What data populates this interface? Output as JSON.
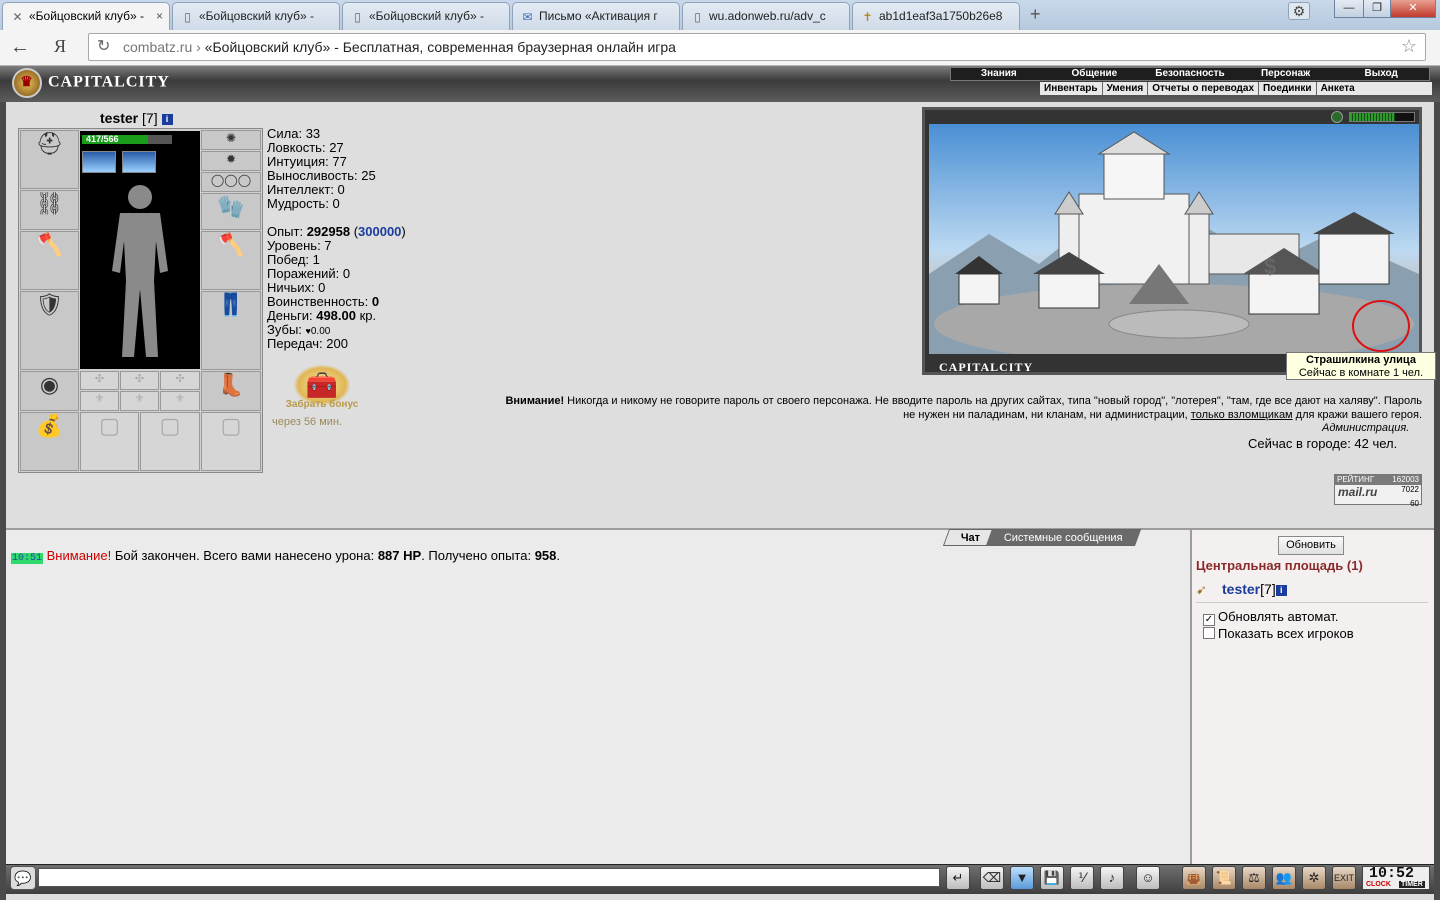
{
  "browser": {
    "tabs": [
      {
        "label": "«Бойцовский клуб» -",
        "icon": "swords-favicon",
        "active": true
      },
      {
        "label": "«Бойцовский клуб» -",
        "icon": "page-favicon"
      },
      {
        "label": "«Бойцовский клуб» -",
        "icon": "page-favicon"
      },
      {
        "label": "Письмо «Активация г",
        "icon": "mail-favicon"
      },
      {
        "label": "wu.adonweb.ru/adv_c",
        "icon": "page-favicon"
      },
      {
        "label": "ab1d1eaf3a1750b26e8",
        "icon": "cross-favicon"
      }
    ],
    "tab_close": "×",
    "new_tab": "+",
    "window_buttons": [
      "—",
      "❐",
      "✕"
    ],
    "back": "←",
    "yandex": "Я",
    "url_domain": "combatz.ru",
    "url_sep": " › ",
    "url_title": "«Бойцовский клуб» - Бесплатная, современная браузерная онлайн игра"
  },
  "game": {
    "logo": "CAPITALCITY",
    "nav_top": [
      "Знания",
      "Общение",
      "Безопасность",
      "Персонаж",
      "Выход"
    ],
    "nav_sub": [
      "Инвентарь",
      "Умения",
      "Отчеты о переводах",
      "Поединки",
      "Анкета"
    ],
    "character": {
      "name": "tester",
      "level": "[7]",
      "info": "i",
      "hp_text": "417/566",
      "hp_fraction": 0.737
    },
    "stats": [
      {
        "label": "Сила: ",
        "value": "33"
      },
      {
        "label": "Ловкость: ",
        "value": "27"
      },
      {
        "label": "Интуиция: ",
        "value": "77"
      },
      {
        "label": "Выносливость: ",
        "value": "25"
      },
      {
        "label": "Интеллект: ",
        "value": "0"
      },
      {
        "label": "Мудрость: ",
        "value": "0"
      }
    ],
    "stats2": {
      "exp_label": "Опыт: ",
      "exp_value": "292958",
      "exp_next": "300000",
      "level": "Уровень: 7",
      "wins": "Побед: 1",
      "losses": "Поражений: 0",
      "draws": "Ничьих: 0",
      "belligerence_label": "Воинственность: ",
      "belligerence_value": "0",
      "money_label": "Деньги: ",
      "money_value": "498.00",
      "money_unit": " кр.",
      "teeth_label": "Зубы: ",
      "teeth_value": "0.00",
      "transfers": "Передач: 200"
    },
    "bonus": {
      "label": "Забрать бонус",
      "time": "через 56 мин."
    },
    "map": {
      "caption": "CAPITALCITY",
      "tooltip_title": "Страшилкина улица",
      "tooltip_sub": "Сейчас в комнате 1 чел."
    },
    "warning": {
      "bold": "Внимание!",
      "text1": " Никогда и никому не говорите пароль от своего персонажа. Не вводите пароль на других сайтах, типа \"новый город\", \"лотерея\", \"там, где все дают на халяву\". Пароль не нужен ни паладинам, ни кланам, ни администрации, ",
      "link": "только взломщикам",
      "text2": " для кражи вашего героя.",
      "sign": "Администрация."
    },
    "online": "Сейчас в городе: 42 чел.",
    "rating": {
      "label": "РЕЙТИНГ",
      "v1": "162003",
      "v2": "7022",
      "v3": "60",
      "brand": "mail.ru"
    },
    "chat": {
      "tabs": [
        "Чат",
        "Системные сообщения"
      ],
      "message": {
        "time": "10:51",
        "warn": "Внимание!",
        "t1": " Бой закончен. Всего вами нанесено урона: ",
        "damage": "887 HP",
        "t2": ". Получено опыта: ",
        "exp": "958",
        "t3": "."
      }
    },
    "room": {
      "refresh": "Обновить",
      "title": "Центральная площадь (1)",
      "user_name": "tester",
      "user_level": "[7]",
      "opt_auto": "Обновлять автомат.",
      "opt_all": "Показать всех игроков"
    },
    "clock": {
      "time": "10:52",
      "clock_label": "CLOCK",
      "timer_label": "TIMER"
    }
  }
}
